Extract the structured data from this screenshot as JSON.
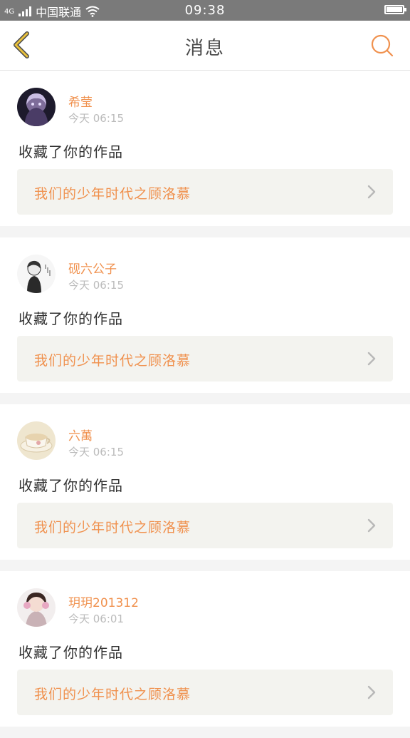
{
  "status_bar": {
    "network": "4G",
    "carrier": "中国联通",
    "time": "09:38"
  },
  "header": {
    "title": "消息"
  },
  "colors": {
    "accent": "#f0914e",
    "back_icon": "#e9c13b",
    "link_bg": "#f3f3ef"
  },
  "messages": [
    {
      "username": "希莹",
      "time": "今天 06:15",
      "action": "收藏了你的作品",
      "work_title": "我们的少年时代之顾洛慕",
      "avatar": "avatar-dark-girl"
    },
    {
      "username": "砚六公子",
      "time": "今天 06:15",
      "action": "收藏了你的作品",
      "work_title": "我们的少年时代之顾洛慕",
      "avatar": "avatar-sketch-boy"
    },
    {
      "username": "六萬",
      "time": "今天 06:15",
      "action": "收藏了你的作品",
      "work_title": "我们的少年时代之顾洛慕",
      "avatar": "avatar-teacup"
    },
    {
      "username": "玥玥201312",
      "time": "今天 06:01",
      "action": "收藏了你的作品",
      "work_title": "我们的少年时代之顾洛慕",
      "avatar": "avatar-headphone-girl"
    }
  ]
}
